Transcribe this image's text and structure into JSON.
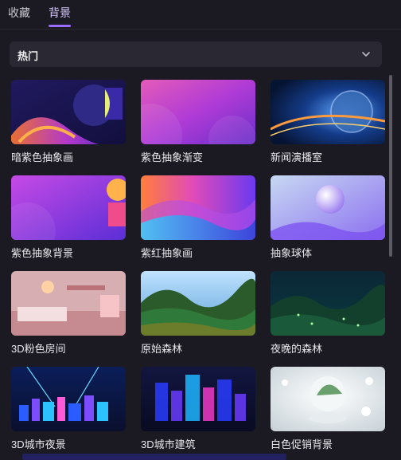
{
  "tabs": {
    "favorites": "收藏",
    "background": "背景"
  },
  "dropdown": {
    "selected": "热门"
  },
  "items": [
    {
      "label": "暗紫色抽象画"
    },
    {
      "label": "紫色抽象渐变"
    },
    {
      "label": "新闻演播室"
    },
    {
      "label": "紫色抽象背景"
    },
    {
      "label": "紫红抽象画"
    },
    {
      "label": "抽象球体"
    },
    {
      "label": "3D粉色房间"
    },
    {
      "label": "原始森林"
    },
    {
      "label": "夜晚的森林"
    },
    {
      "label": "3D城市夜景"
    },
    {
      "label": "3D城市建筑"
    },
    {
      "label": "白色促销背景"
    }
  ],
  "icons": {
    "dropdown": "chevron-down-icon"
  },
  "colors": {
    "accent": "#9a6bff",
    "background": "#1b1a22",
    "panel": "#2a2933"
  }
}
